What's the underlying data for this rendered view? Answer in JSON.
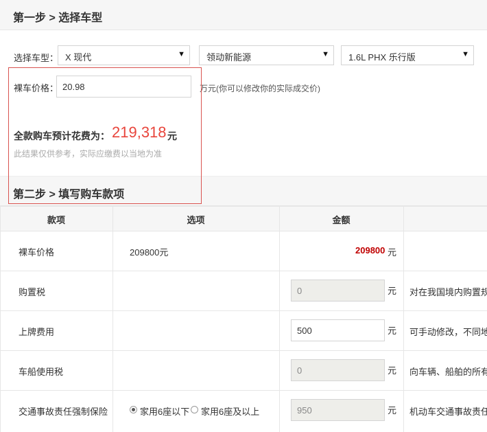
{
  "step1": {
    "title": "第一步 > 选择车型"
  },
  "model": {
    "label": "选择车型：",
    "brand": "X 现代",
    "series": "领动新能源",
    "trim": "1.6L PHX 乐行版"
  },
  "price": {
    "label": "裸车价格：",
    "value": "20.98",
    "unit_hint": "万元(你可以修改你的实际成交价)"
  },
  "total": {
    "label": "全款购车预计花费为：",
    "value": "219,318",
    "unit": "元",
    "note": "此结果仅供参考，实际应缴费以当地为准"
  },
  "step2": {
    "title": "第二步 > 填写购车款项"
  },
  "table": {
    "headers": [
      "款项",
      "选项",
      "金额"
    ],
    "unit": "元",
    "rows": {
      "bare_price": {
        "name": "裸车价格",
        "option": "209800元",
        "amount": "209800"
      },
      "purchase_tax": {
        "name": "购置税",
        "amount": "0",
        "desc": "对在我国境内购置规"
      },
      "plate_fee": {
        "name": "上牌费用",
        "amount": "500",
        "desc": "可手动修改，不同地"
      },
      "vessel_tax": {
        "name": "车船使用税",
        "amount": "0",
        "desc": "向车辆、船舶的所有"
      },
      "insurance": {
        "name": "交通事故责任强制保险",
        "option_a": "家用6座以下",
        "option_b": "家用6座及以上",
        "amount": "950",
        "desc": "机动车交通事故责任"
      }
    }
  }
}
